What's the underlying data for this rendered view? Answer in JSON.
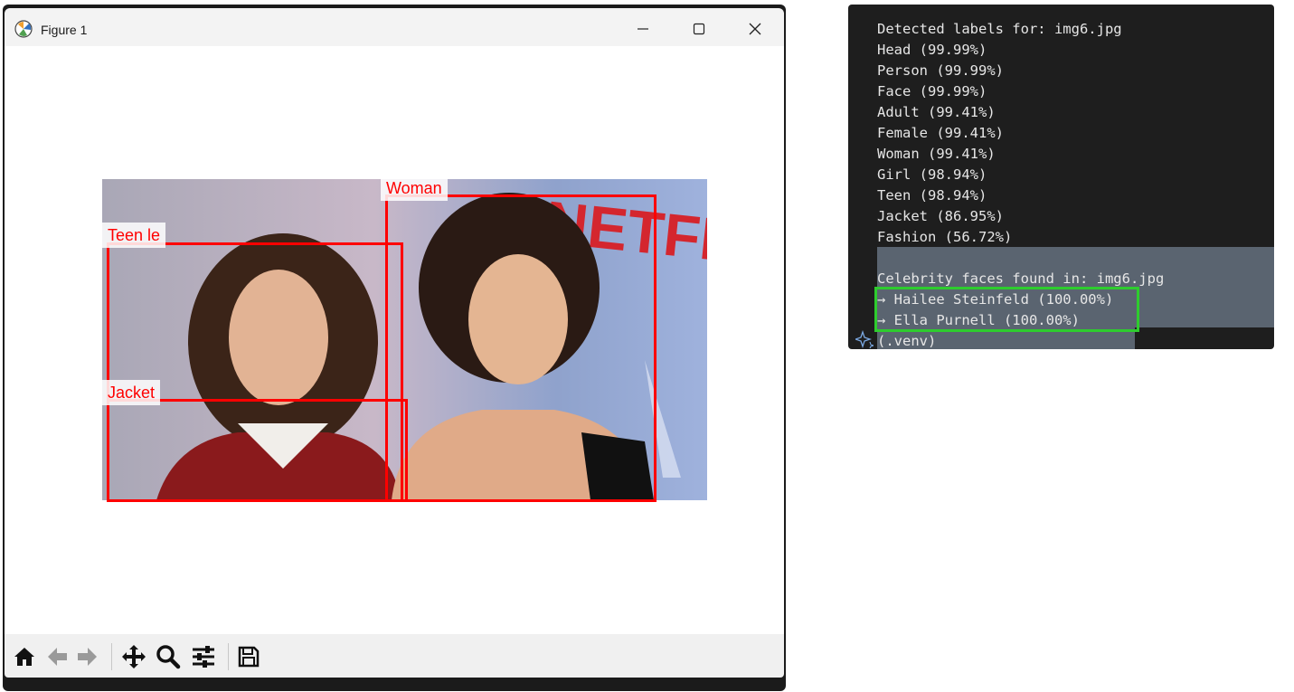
{
  "window": {
    "title": "Figure 1",
    "minimize_icon": "minimize-icon",
    "maximize_icon": "maximize-icon",
    "close_icon": "close-icon"
  },
  "figure": {
    "labels": [
      {
        "text": "Woman"
      },
      {
        "text": "Teen  le"
      },
      {
        "text": "Jacket"
      }
    ],
    "photo_text": "NETFLIX",
    "box_color": "#ff0000"
  },
  "toolbar": {
    "buttons": [
      "home-icon",
      "back-icon",
      "forward-icon",
      "pan-icon",
      "zoom-icon",
      "configure-subplots-icon",
      "save-icon"
    ]
  },
  "terminal": {
    "lines": [
      "Detected labels for: img6.jpg",
      "Head (99.99%)",
      "Person (99.99%)",
      "Face (99.99%)",
      "Adult (99.41%)",
      "Female (99.41%)",
      "Woman (99.41%)",
      "Girl (98.94%)",
      "Teen (98.94%)",
      "Jacket (86.95%)",
      "Fashion (56.72%)",
      "",
      "Celebrity faces found in: img6.jpg",
      "→ Hailee Steinfeld (100.00%)",
      "→ Ella Purnell (100.00%)",
      "(.venv)"
    ],
    "highlight_color": "#2ecc2e"
  }
}
